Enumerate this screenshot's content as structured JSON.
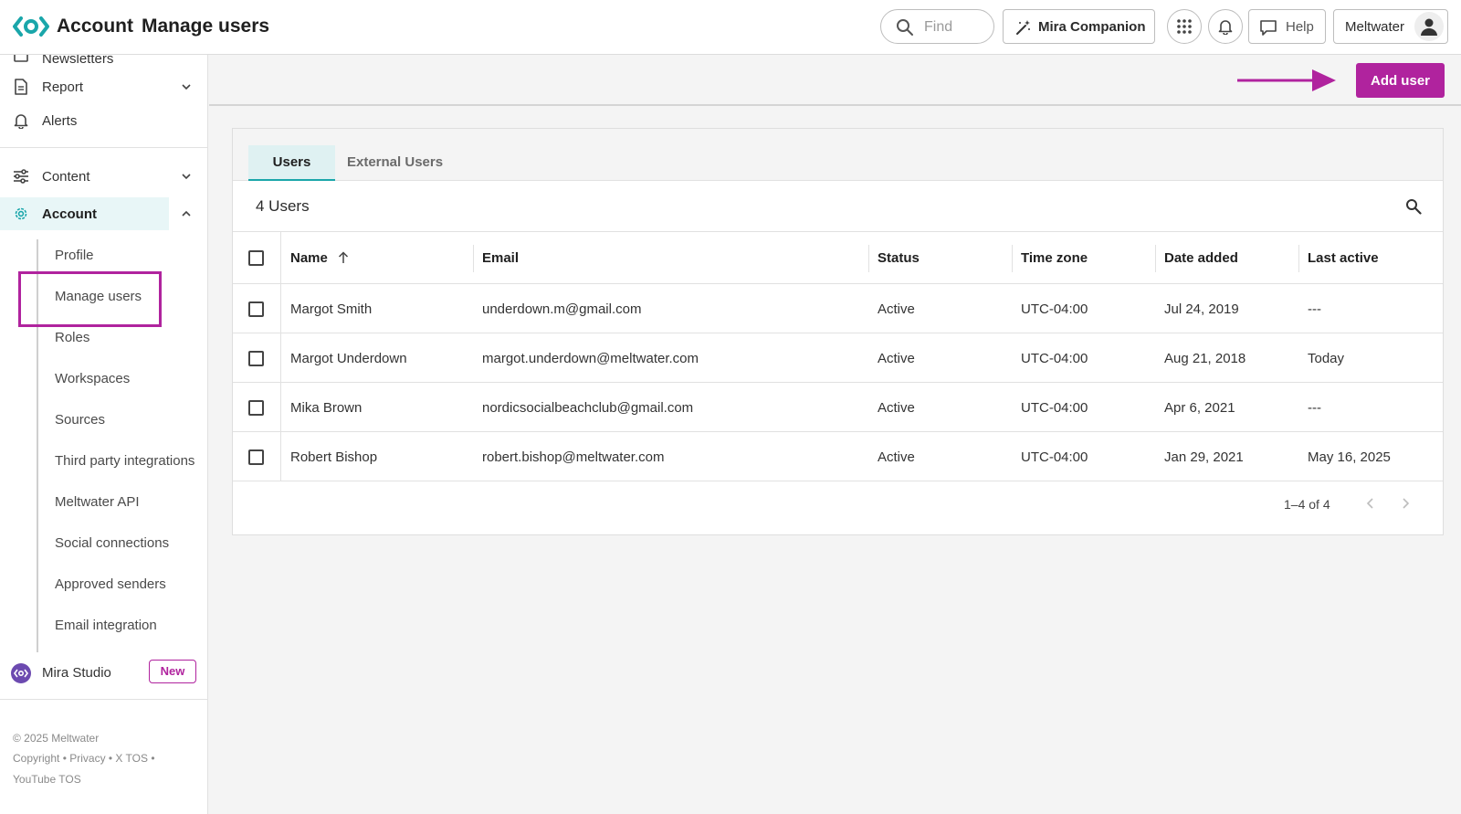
{
  "header": {
    "section": "Account",
    "page": "Manage users",
    "find_placeholder": "Find",
    "mira_companion": "Mira Companion",
    "help": "Help",
    "user_name": "Meltwater"
  },
  "sidebar": {
    "clipped_item": "Newsletters",
    "items": [
      {
        "label": "Report"
      },
      {
        "label": "Alerts"
      },
      {
        "label": "Content"
      },
      {
        "label": "Account"
      }
    ],
    "account_sub": [
      "Profile",
      "Manage users",
      "Roles",
      "Workspaces",
      "Sources",
      "Third party integrations",
      "Meltwater API",
      "Social connections",
      "Approved senders",
      "Email integration"
    ],
    "mira_studio": "Mira Studio",
    "new_badge": "New",
    "footer": {
      "copyright": "© 2025 Meltwater",
      "links_line1": "Copyright • Privacy • X TOS •",
      "links_line2": "YouTube TOS"
    }
  },
  "actions": {
    "add_user": "Add user"
  },
  "tabs": {
    "users": "Users",
    "external": "External Users"
  },
  "table": {
    "count_label": "4 Users",
    "columns": [
      "Name",
      "Email",
      "Status",
      "Time zone",
      "Date added",
      "Last active"
    ],
    "rows": [
      [
        "Margot Smith",
        "underdown.m@gmail.com",
        "Active",
        "UTC-04:00",
        "Jul 24, 2019",
        "---"
      ],
      [
        "Margot Underdown",
        "margot.underdown@meltwater.com",
        "Active",
        "UTC-04:00",
        "Aug 21, 2018",
        "Today"
      ],
      [
        "Mika Brown",
        "nordicsocialbeachclub@gmail.com",
        "Active",
        "UTC-04:00",
        "Apr 6, 2021",
        "---"
      ],
      [
        "Robert Bishop",
        "robert.bishop@meltwater.com",
        "Active",
        "UTC-04:00",
        "Jan 29, 2021",
        "May 16, 2025"
      ]
    ],
    "pagination": "1–4 of 4"
  },
  "colors": {
    "accent": "#b0239e",
    "teal": "#1aa6aa",
    "tab_bg": "#dff1f2"
  }
}
